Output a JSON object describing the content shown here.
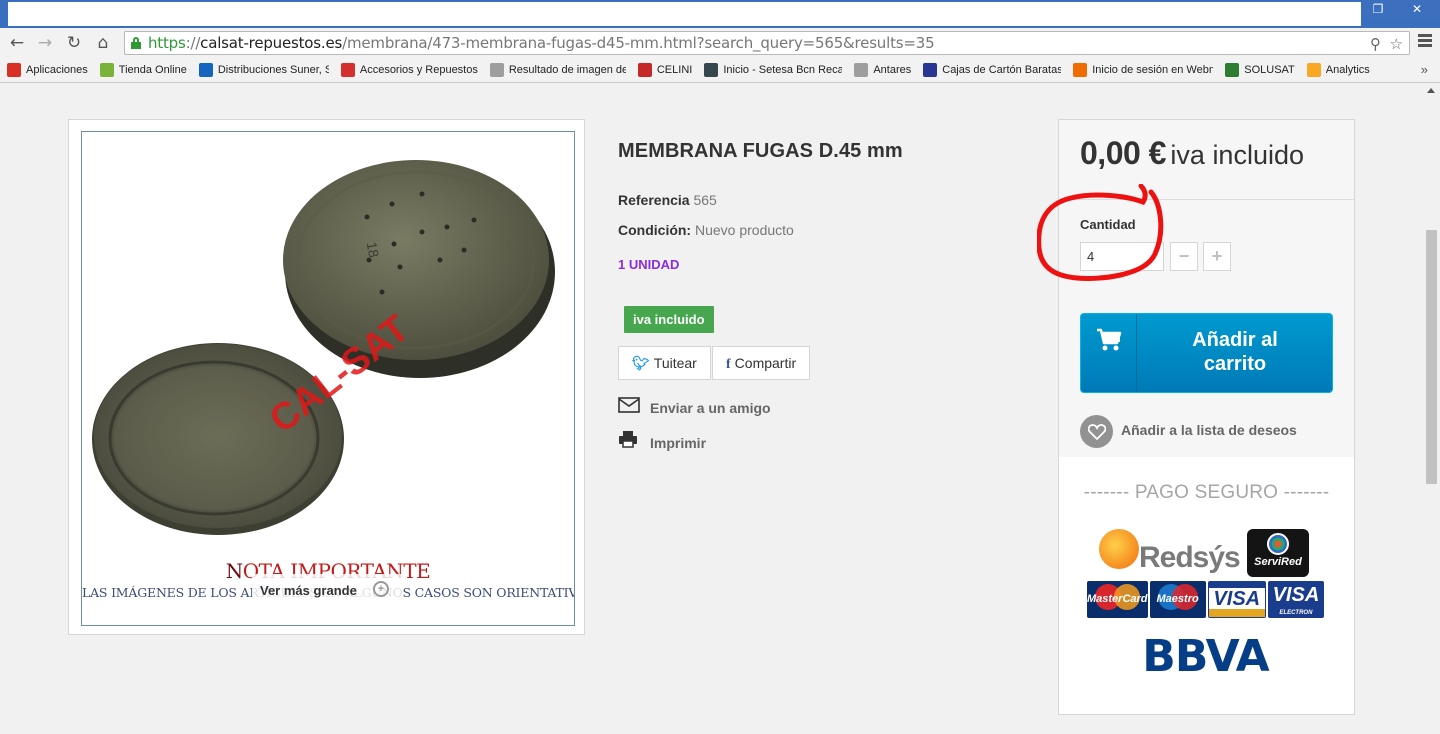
{
  "browser": {
    "url_scheme": "https",
    "url_sep": "://",
    "url_host": "calsat-repuestos.es",
    "url_path": "/membrana/473-membrana-fugas-d45-mm.html?search_query=565&results=35",
    "bookmarks": [
      {
        "label": "Aplicaciones",
        "color": "#d93025"
      },
      {
        "label": "Tienda Online",
        "color": "#7bb33a"
      },
      {
        "label": "Distribuciones Suner, S.L",
        "color": "#1565c0"
      },
      {
        "label": "Accesorios y Repuestos",
        "color": "#d32f2f"
      },
      {
        "label": "Resultado de imagen de",
        "color": "#9e9e9e"
      },
      {
        "label": "CELINI",
        "color": "#c62828"
      },
      {
        "label": "Inicio - Setesa Bcn Recambios",
        "color": "#37474f"
      },
      {
        "label": "Antares",
        "color": "#9e9e9e"
      },
      {
        "label": "Cajas de Cartón Baratas",
        "color": "#283593"
      },
      {
        "label": "Inicio de sesión en Webmail",
        "color": "#ef6c00"
      },
      {
        "label": "SOLUSAT",
        "color": "#2e7d32"
      },
      {
        "label": "Analytics",
        "color": "#f9a825"
      }
    ],
    "more_glyph": "»"
  },
  "product": {
    "image": {
      "watermark": "CAL-SAT",
      "nota_first": "N",
      "nota_rest": "OTA IMPORTANTE",
      "nota_sub": "LAS IMÁGENES DE LOS ARTÍCULOS EN ALGUNOS CASOS SON ORIENTATIVAS",
      "zoom_label": "Ver más grande",
      "emboss_text": "18"
    },
    "title": "MEMBRANA FUGAS D.45 mm",
    "reference_label": "Referencia",
    "reference_value": "565",
    "condition_label": "Condición:",
    "condition_value": "Nuevo producto",
    "unidad": "1 UNIDAD",
    "iva_badge": "iva incluido",
    "tweet_label": "Tuitear",
    "share_label": "Compartir",
    "send_friend": "Enviar a un amigo",
    "print": "Imprimir"
  },
  "buy": {
    "price": "0,00 €",
    "price_suffix": "iva incluido",
    "qty_label": "Cantidad",
    "qty_value": "4",
    "minus": "−",
    "plus": "+",
    "cart_line1": "Añadir al",
    "cart_line2": "carrito",
    "wishlist": "Añadir a la lista de deseos",
    "pago_seguro": "------- PAGO SEGURO -------",
    "logos": {
      "redsys": "Redsýs",
      "servired": "ServiRed",
      "mastercard": "MasterCard",
      "maestro": "Maestro",
      "visa": "VISA",
      "visa_electron": "VISA",
      "electron": "ELECTRON",
      "bbva": "BBVA"
    }
  },
  "colors": {
    "accent_blue": "#007ab7",
    "badge_green": "#46a74e",
    "unidad_purple": "#8a2be2",
    "annotation_red": "#ee1111"
  }
}
